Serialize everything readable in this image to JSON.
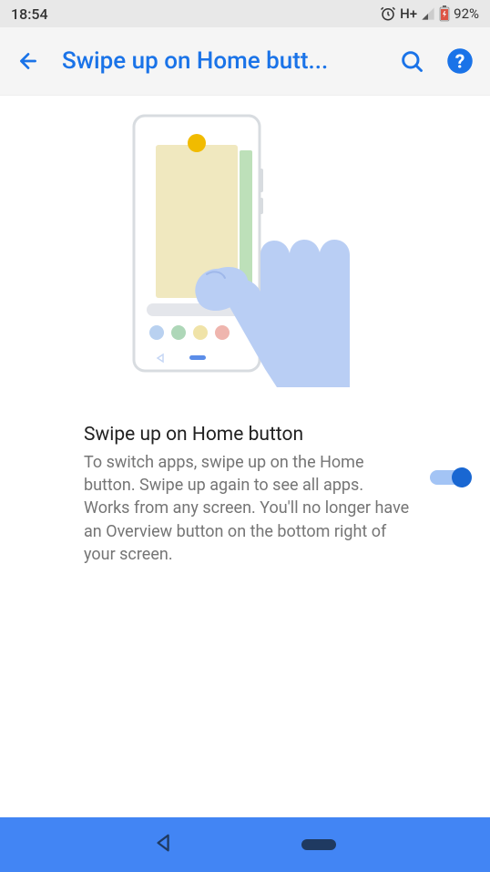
{
  "statusBar": {
    "time": "18:54",
    "network": "H+",
    "battery": "92%"
  },
  "appBar": {
    "title": "Swipe up on Home butt..."
  },
  "setting": {
    "title": "Swipe up on Home button",
    "description": "To switch apps, swipe up on the Home button. Swipe up again to see all apps. Works from any screen. You'll no longer have an Overview button on the bottom right of your screen.",
    "enabled": true
  },
  "illustration": {
    "dotColors": [
      "#b9d1f0",
      "#aed7b8",
      "#f0e3a8",
      "#efb5ae"
    ],
    "cardColor": "#f0e8bf",
    "sidebarColor": "#bde0b9",
    "handColor": "#b9cef4",
    "homeDotColor": "#f1bb00"
  }
}
